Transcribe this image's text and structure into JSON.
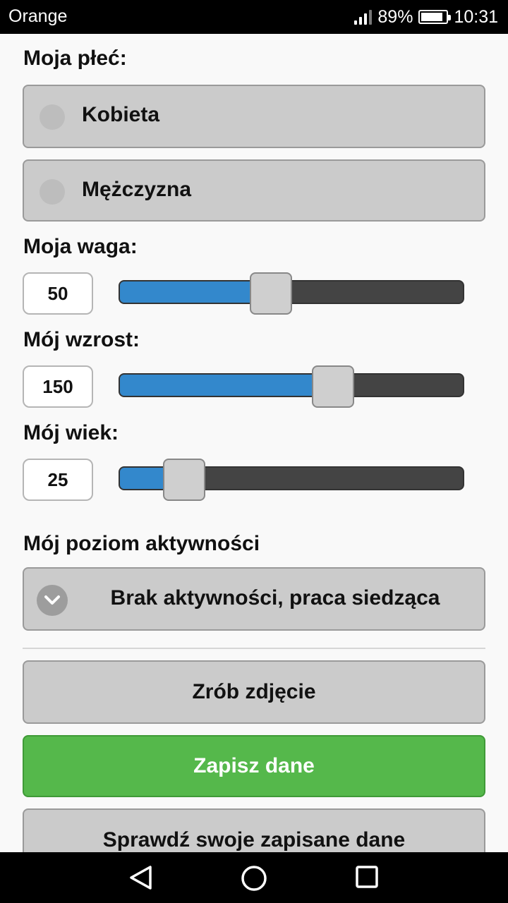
{
  "status_bar": {
    "carrier": "Orange",
    "battery_percent": "89%",
    "battery_level": 0.89,
    "time": "10:31"
  },
  "gender": {
    "label": "Moja płeć:",
    "options": [
      "Kobieta",
      "Mężczyzna"
    ]
  },
  "weight": {
    "label": "Moja waga:",
    "value": "50",
    "level": 0.44
  },
  "height": {
    "label": "Mój wzrost:",
    "value": "150",
    "level": 0.62
  },
  "age": {
    "label": "Mój wiek:",
    "value": "25",
    "level": 0.19
  },
  "activity": {
    "label": "Mój poziom aktywności",
    "selected": "Brak aktywności, praca siedząca"
  },
  "buttons": {
    "photo": "Zrób zdjęcie",
    "save": "Zapisz dane",
    "check": "Sprawdź swoje zapisane dane"
  },
  "colors": {
    "slider_fill": "#3388cc",
    "save_button": "#55b84b"
  },
  "icons": {
    "status": [
      "signal-icon",
      "battery-icon"
    ],
    "select": "chevron-down-icon",
    "nav": [
      "back-icon",
      "home-icon",
      "recents-icon"
    ]
  }
}
